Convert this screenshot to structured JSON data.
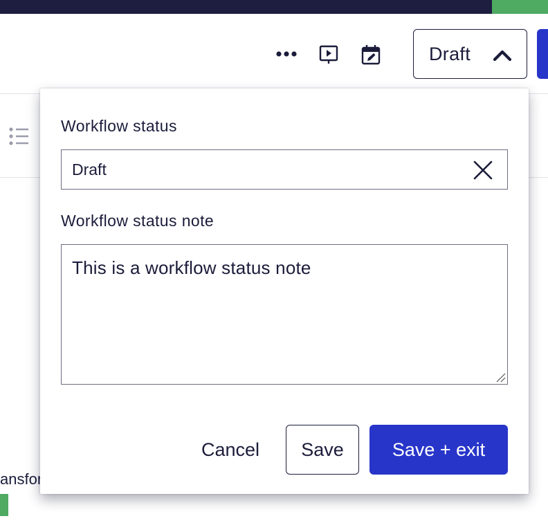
{
  "colors": {
    "top_strip": "#1d1e40",
    "accent_green": "#4faa62",
    "primary": "#2735c9",
    "text": "#1b1c3a"
  },
  "toolbar": {
    "icons": [
      "more-icon",
      "preview-icon",
      "schedule-icon"
    ],
    "status_button_label": "Draft"
  },
  "background": {
    "fragment_text": "ansfor"
  },
  "popover": {
    "workflow_status_label": "Workflow status",
    "workflow_status_value": "Draft",
    "workflow_status_note_label": "Workflow status note",
    "workflow_status_note_value": "This is a workflow status note",
    "cancel_label": "Cancel",
    "save_label": "Save",
    "save_exit_label": "Save + exit"
  }
}
